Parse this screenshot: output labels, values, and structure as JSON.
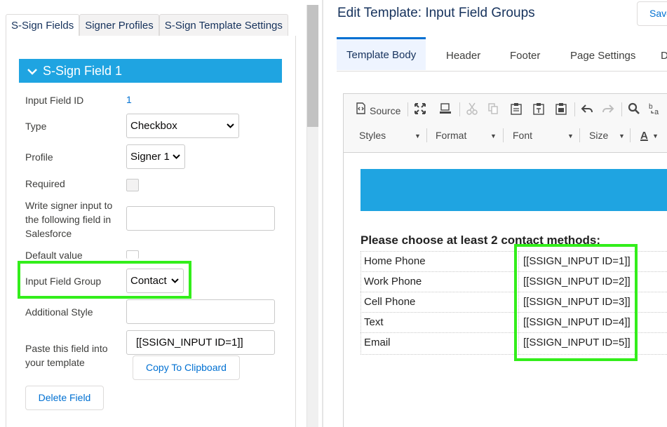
{
  "left_panel": {
    "tabs": [
      "S-Sign Fields",
      "Signer Profiles",
      "S-Sign Template Settings"
    ],
    "section_title": "S-Sign Field 1",
    "fields": {
      "input_field_id_label": "Input Field ID",
      "input_field_id_value": "1",
      "type_label": "Type",
      "type_value": "Checkbox",
      "profile_label": "Profile",
      "profile_value": "Signer 1",
      "required_label": "Required",
      "write_signer_label_1": "Write signer input to",
      "write_signer_label_2": "the following field in",
      "write_signer_label_3": "Salesforce",
      "default_value_label": "Default value",
      "input_field_group_label": "Input Field Group",
      "input_field_group_value": "Contact",
      "additional_style_label": "Additional Style",
      "paste_label_1": "Paste this field into",
      "paste_label_2": "your template",
      "paste_value": "[[SSIGN_INPUT ID=1]]"
    },
    "buttons": {
      "copy": "Copy To Clipboard",
      "delete": "Delete Field"
    }
  },
  "right_panel": {
    "title": "Edit Template: Input Field Groups",
    "save_button": "Save",
    "tabs": [
      "Template Body",
      "Header",
      "Footer",
      "Page Settings",
      "D"
    ],
    "toolbar": {
      "source_label": "Source",
      "styles": "Styles",
      "format": "Format",
      "font": "Font",
      "size": "Size",
      "text_color": "A"
    },
    "document": {
      "heading": "Please choose at least 2 contact methods:",
      "rows": [
        {
          "label": "Home Phone",
          "code": "[[SSIGN_INPUT ID=1]]"
        },
        {
          "label": "Work Phone",
          "code": "[[SSIGN_INPUT ID=2]]"
        },
        {
          "label": "Cell Phone",
          "code": "[[SSIGN_INPUT ID=3]]"
        },
        {
          "label": "Text",
          "code": "[[SSIGN_INPUT ID=4]]"
        },
        {
          "label": "Email",
          "code": "[[SSIGN_INPUT ID=5]]"
        }
      ]
    }
  },
  "colors": {
    "accent_blue": "#1fa4e1",
    "highlight_green": "#33ee1b",
    "link_blue": "#0070d2"
  }
}
